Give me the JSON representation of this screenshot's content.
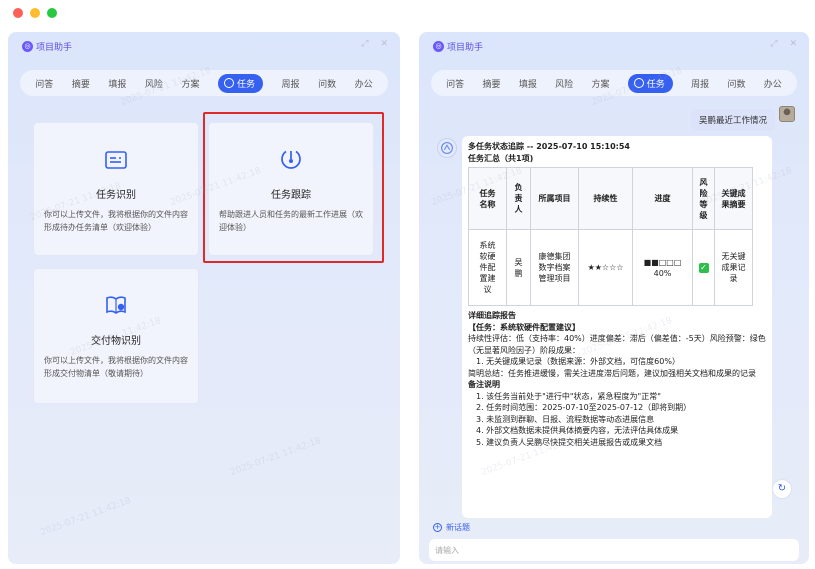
{
  "left_panel": {
    "title": "项目助手",
    "tabs": [
      "问答",
      "摘要",
      "填报",
      "风险",
      "方案",
      "任务",
      "周报",
      "问数",
      "办公"
    ],
    "active_tab": "任务",
    "cards": {
      "task_identify": {
        "title": "任务识别",
        "desc": "你可以上传文件，我将根据你的文件内容形成待办任务清单（欢迎体验）"
      },
      "task_tracking": {
        "title": "任务跟踪",
        "desc": "帮助跟进人员和任务的最新工作进展（欢迎体验）"
      },
      "deliverable_identify": {
        "title": "交付物识别",
        "desc": "你可以上传文件，我将根据你的文件内容形成交付物清单（敬请期待）"
      }
    }
  },
  "right_panel": {
    "title": "项目助手",
    "tabs": [
      "问答",
      "摘要",
      "填报",
      "风险",
      "方案",
      "任务",
      "周报",
      "问数",
      "办公"
    ],
    "active_tab": "任务",
    "user_message": "吴鹏最近工作情况",
    "response": {
      "line1": "多任务状态追踪 -- 2025-07-10 15:10:54",
      "line2": "任务汇总（共1项)",
      "table": {
        "headers": [
          "任务名称",
          "负责人",
          "所属项目",
          "持续性",
          "进度",
          "风险等级",
          "关键成果摘要"
        ],
        "row": {
          "name": "系统软硬件配置建议",
          "owner": "吴鹏",
          "project": "康德集团数字档案管理项目",
          "continuity": "★★☆☆☆",
          "progress_bar": "■■□□□",
          "progress_pct": "40%",
          "risk_mark": "✓",
          "summary": "无关键成果记录"
        }
      },
      "detail_title": "详细追踪报告",
      "task_title": "【任务：系统软硬件配置建议】",
      "detail_line1": "持续性评估：低（支持率：40%）进度偏差：滞后（偏差值：-5天）风险预警：绿色（无显著风险因子）阶段成果：",
      "detail_item1": "1. 无关键成果记录（数据来源：外部文档，可信度60%）",
      "summary": "简明总结：任务推进缓慢，需关注进度滞后问题，建议加强相关文档和成果的记录",
      "notes_title": "备注说明",
      "notes": [
        "1. 该任务当前处于\"进行中\"状态，紧急程度为\"正常\"",
        "2. 任务时间范围：2025-07-10至2025-07-12（即将到期）",
        "3. 未监测到群聊、日报、流程数据等动态进展信息",
        "4. 外部文档数据未提供具体摘要内容，无法评估具体成果",
        "5. 建议负责人吴鹏尽快提交相关进展报告或成果文档"
      ]
    },
    "new_topic": "新话题",
    "input_placeholder": "请输入"
  },
  "watermark_text": "2025-07-21 11:42:18"
}
